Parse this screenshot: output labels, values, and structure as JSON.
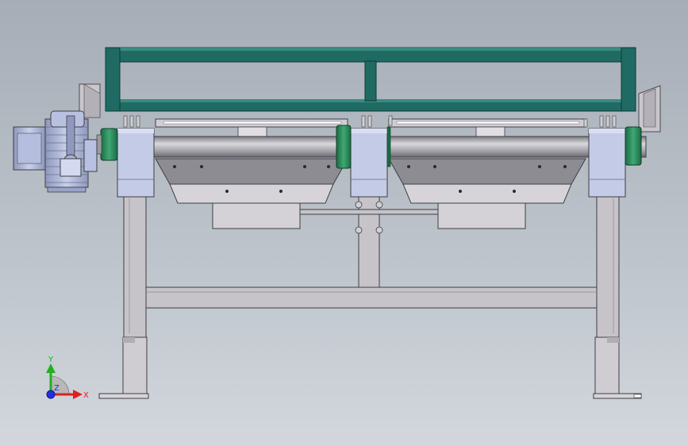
{
  "viewport": {
    "background_top": "#a6adb6",
    "background_bottom": "#d3d7dd"
  },
  "colors": {
    "frame_teal": "#1f6b63",
    "frame_teal_light": "#3a8a80",
    "steel_gray": "#c6c4c9",
    "steel_dark": "#8e8c93",
    "bearing_blue": "#c4cbe7",
    "coupling_green": "#2c8a5a",
    "shaft_gray": "#9a9aa0",
    "motor_blue": "#aab4d6",
    "axis_x": "#e02020",
    "axis_y": "#20b020",
    "axis_z": "#2030e0"
  },
  "axes": {
    "x_label": "X",
    "y_label": "Y",
    "z_label": "Z"
  }
}
